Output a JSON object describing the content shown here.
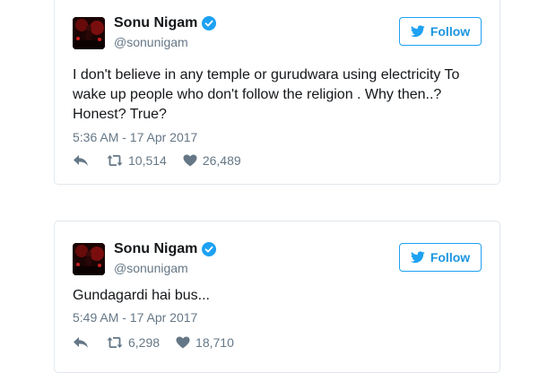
{
  "colors": {
    "accent": "#1da1f2",
    "text": "#14171a",
    "muted": "#657786",
    "border": "#e1e8ed"
  },
  "icons": {
    "verified": "verified-badge-icon",
    "follow": "twitter-bird-icon",
    "reply": "reply-icon",
    "retweet": "retweet-icon",
    "like": "heart-icon"
  },
  "tweets": [
    {
      "author": {
        "name": "Sonu Nigam",
        "handle": "@sonunigam"
      },
      "follow_label": "Follow",
      "text": "I don't believe in any temple or gurudwara using electricity To wake up people who don't follow the religion . Why then..? Honest? True?",
      "timestamp": "5:36 AM - 17 Apr 2017",
      "retweets": "10,514",
      "likes": "26,489"
    },
    {
      "author": {
        "name": "Sonu Nigam",
        "handle": "@sonunigam"
      },
      "follow_label": "Follow",
      "text": "Gundagardi hai bus...",
      "timestamp": "5:49 AM - 17 Apr 2017",
      "retweets": "6,298",
      "likes": "18,710"
    }
  ]
}
